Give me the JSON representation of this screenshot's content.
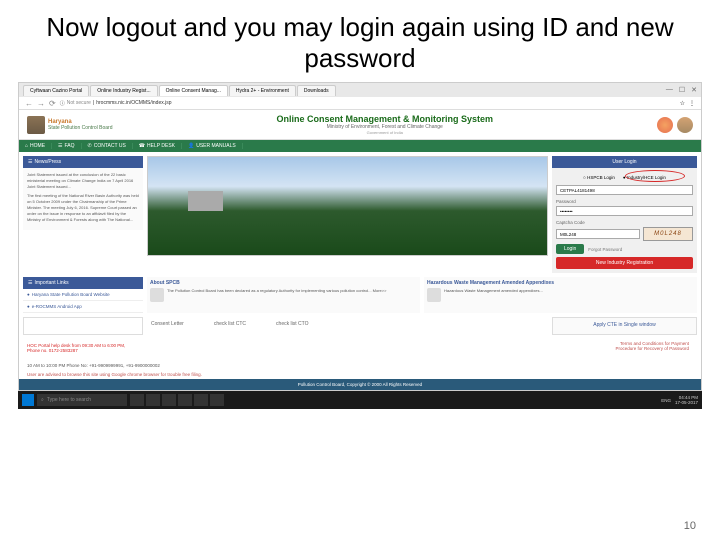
{
  "slide": {
    "title": "Now logout and you may login again using  ID and new password",
    "page_number": "10"
  },
  "browser": {
    "tabs": [
      "Cyftwaan Cazino Portal",
      "Online Industry Regist...",
      "Online Consent Manag...",
      "Hydra 2+ - Environment",
      "Downloads"
    ],
    "url_warning": "Not secure",
    "url": "hrocmms.nic.in/OCMMS/index.jsp"
  },
  "header": {
    "state": "Haryana",
    "board": "State Pollution Control Board",
    "title": "Online Consent Management & Monitoring System",
    "ministry": "Ministry of Environment, Forest and Climate Change",
    "gov": "Government of India"
  },
  "nav": {
    "home": "HOME",
    "faq": "FAQ",
    "contact": "CONTACT US",
    "help": "HELP DESK",
    "manuals": "USER MANUALS"
  },
  "news": {
    "header": "News/Press",
    "item1": "Joint Statement issued at the conclusion of the 22 basic ministerial meeting on Climate Change India on 7 April 2016 Joint Statement issued...",
    "item2": "The first meeting of the National River Basin Authority was held on 5 October 2009 under the Chairmanship of the Prime Minister. The meeting July 6, 2016. Supreme Court passed an order on the issue in response to an affidavit filed by the Ministry of Environment & Forests along with The National..."
  },
  "login": {
    "header": "User Login",
    "radio1": "HSPCB Login",
    "radio2": "Industry/HCE Login",
    "user_value": "CETPAL4181498",
    "pwd_label": "Password",
    "captcha_label": "Captcha Code",
    "captcha_input": "M0L248",
    "captcha_display": "M0L248",
    "login_btn": "Login",
    "forgot": "Forgot Password",
    "register": "New Industry Registration"
  },
  "links": {
    "header": "Important Links",
    "l1": "Haryana State Pollution Board Website",
    "l2": "e-ROCMMS Android App"
  },
  "about": {
    "t1": "About SPCB",
    "c1": "The Pollution Control Board has been declared as a regulatory Authority for implementing various pollution control... More>>",
    "t2": "Hazardous Waste Management Amended Appendixes",
    "c2": "Hazardous Waste Management amended appendixes..."
  },
  "checks": {
    "c1": "Consent Letter",
    "ctc": "check list CTC",
    "cto": "check list CTO"
  },
  "apply": {
    "text": "Apply CTE in Single window"
  },
  "help": {
    "text": "HOC Portal help desk from 09:30 AM to 6:00 PM, Phone no. 0172-2583287"
  },
  "cond": {
    "title": "Terms and Conditions for Payment",
    "recovery": "Procedure for Recovery of Password"
  },
  "footer": {
    "phone": "10 AM to 10:00 PM Phone No: +91-9909999991, +91-9900000002",
    "advisory": "User are advised to browse this site using Google chrome browser for trouble free filing.",
    "copyright": "Pollution Control Board, Copyright © 2000 All Rights Reserved"
  },
  "taskbar": {
    "search": "Type here to search",
    "lang": "ENG",
    "time": "04:44 PM",
    "date": "17-05-2017"
  }
}
